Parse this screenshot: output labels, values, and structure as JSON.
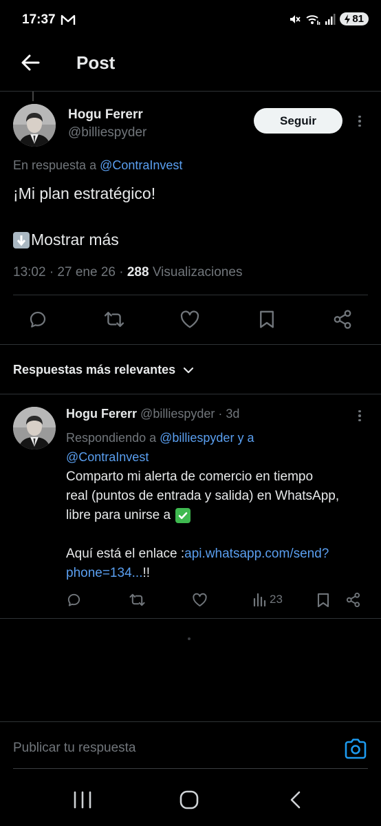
{
  "status_bar": {
    "time": "17:37",
    "battery": "81"
  },
  "header": {
    "title": "Post"
  },
  "post": {
    "author_name": "Hogu Fererr",
    "author_handle": "@billiespyder",
    "follow_label": "Seguir",
    "reply_prefix": "En respuesta a",
    "reply_to": "@ContraInvest",
    "text": "¡Mi plan estratégico!",
    "show_more": "Mostrar más",
    "meta_time": "13:02 · 27 ene 26 · ",
    "views_count": "288",
    "views_label": " Visualizaciones"
  },
  "replies_header": {
    "label": "Respuestas más relevantes"
  },
  "reply": {
    "author_name": "Hogu Fererr",
    "author_handle": "@billiespyder",
    "age": "· 3d",
    "replying_prefix": "Respondiendo a",
    "replying_to_1": "@billiespyder",
    "replying_and": "y a",
    "replying_to_2": "@ContraInvest",
    "line1": "Comparto mi alerta de comercio en tiempo",
    "line2": "real (puntos de entrada y salida) en WhatsApp,",
    "line3": "libre para unirse a",
    "link_prefix": "Aquí está el enlace :",
    "link_part1": "api.whatsapp.com/send?",
    "link_part2": "phone=134...",
    "link_suffix": "!!",
    "views": "23"
  },
  "composer": {
    "placeholder": "Publicar tu respuesta"
  },
  "icons": {
    "accent": "#5a9ff0",
    "reply": "reply-icon",
    "retweet": "retweet-icon",
    "like": "like-icon",
    "bookmark": "bookmark-icon",
    "share": "share-icon",
    "camera": "camera-icon"
  }
}
